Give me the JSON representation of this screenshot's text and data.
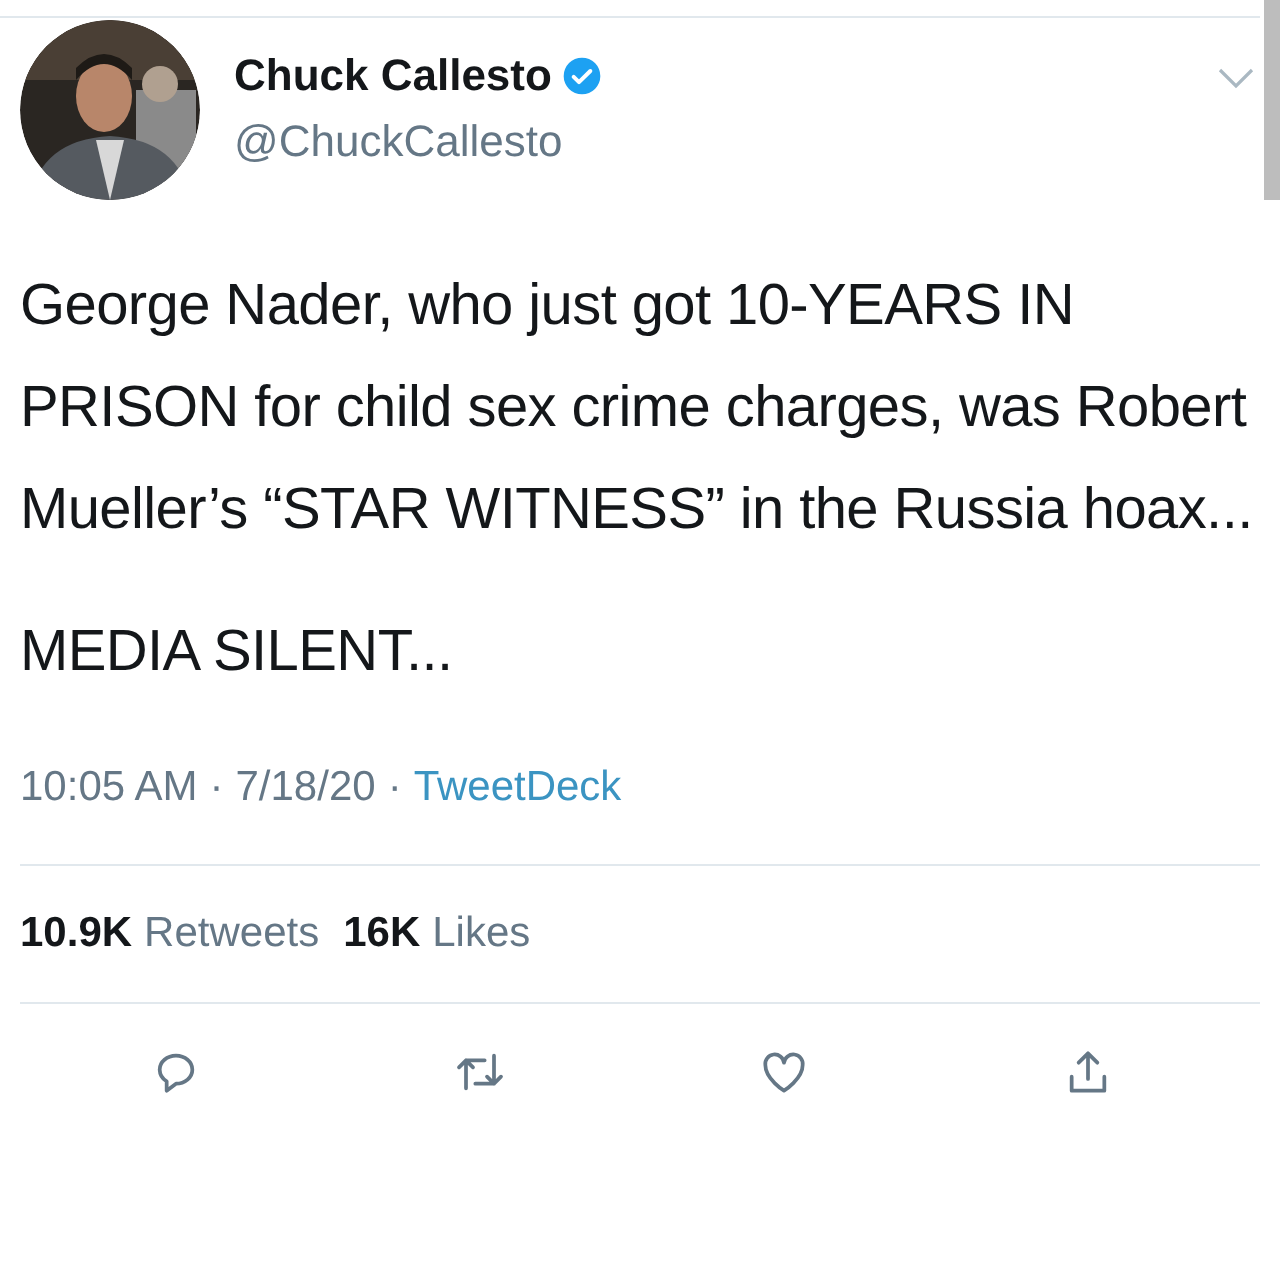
{
  "tweet": {
    "author": {
      "name": "Chuck Callesto",
      "verified": true,
      "handle": "@ChuckCallesto"
    },
    "paragraphs": [
      "George Nader, who just got 10-YEARS IN PRISON for child sex crime charges, was Robert Mueller’s “STAR WITNESS” in the Russia hoax...",
      "MEDIA SILENT..."
    ],
    "meta": {
      "time": "10:05 AM",
      "separator_1": "·",
      "date": "7/18/20",
      "separator_2": "·",
      "source": "TweetDeck"
    },
    "stats": [
      {
        "count": "10.9K",
        "label": "Retweets"
      },
      {
        "count": "16K",
        "label": "Likes"
      }
    ],
    "actions": [
      {
        "kind": "reply"
      },
      {
        "kind": "retweet"
      },
      {
        "kind": "like"
      },
      {
        "kind": "share"
      }
    ]
  }
}
